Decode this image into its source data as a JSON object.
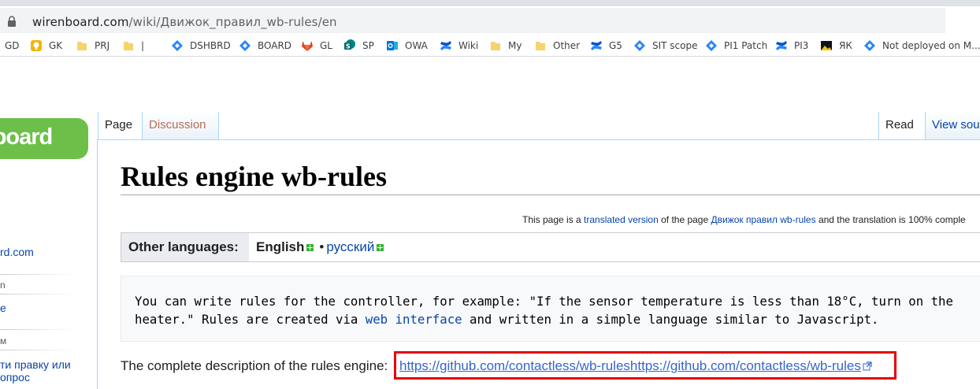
{
  "browser": {
    "url_host": "wirenboard.com",
    "url_path": "/wiki/Движок_правил_wb-rules/en",
    "bookmarks": [
      {
        "label": "GD",
        "icon": "bookmark-favicon"
      },
      {
        "label": "GK",
        "icon": "bulb-icon"
      },
      {
        "label": "PRJ",
        "icon": "folder-icon"
      },
      {
        "label": "|",
        "icon": "folder-icon"
      },
      {
        "label": "DSHBRD",
        "icon": "jira-diamond-icon"
      },
      {
        "label": "BOARD",
        "icon": "jira-diamond-icon"
      },
      {
        "label": "GL",
        "icon": "gitlab-icon"
      },
      {
        "label": "SP",
        "icon": "sharepoint-icon"
      },
      {
        "label": "OWA",
        "icon": "outlook-icon"
      },
      {
        "label": "Wiki",
        "icon": "confluence-icon"
      },
      {
        "label": "My",
        "icon": "folder-icon"
      },
      {
        "label": "Other",
        "icon": "folder-icon"
      },
      {
        "label": "G5",
        "icon": "confluence-icon"
      },
      {
        "label": "SIT scope",
        "icon": "jira-diamond-icon"
      },
      {
        "label": "PI1 Patch",
        "icon": "jira-diamond-icon"
      },
      {
        "label": "PI3",
        "icon": "confluence-icon"
      },
      {
        "label": "ЯК",
        "icon": "image-icon"
      },
      {
        "label": "Not deployed on M...",
        "icon": "jira-diamond-icon"
      }
    ]
  },
  "wiki": {
    "logo_text": "nboard",
    "sidebar": {
      "link1": "rd.com",
      "head1": "n",
      "link2": "e",
      "head2": "м",
      "link3a": "ти правку или",
      "link3b": "опрос"
    },
    "tabs": {
      "page": "Page",
      "discussion": "Discussion",
      "read": "Read",
      "view_source": "View sou"
    },
    "title": "Rules engine wb-rules",
    "translation_notice": {
      "prefix": "This page is a ",
      "link1": "translated version",
      "middle": " of the page ",
      "link2": "Движок правил wb-rules",
      "suffix": " and the translation is 100% comple"
    },
    "languages": {
      "label": "Other languages:",
      "current": "English",
      "separator": "•",
      "other": "русский"
    },
    "note": {
      "text_a": "You can write rules for the controller, for example: \"If the sensor temperature is less than 18°C, turn on the heater.\" Rules are created via ",
      "link": "web interface",
      "text_b": " and written in a simple language similar to Javascript."
    },
    "description": {
      "label": "The complete description of the rules engine:",
      "link": "https://github.com/contactless/wb-ruleshttps://github.com/contactless/wb-rules"
    }
  },
  "colors": {
    "link": "#0645ad",
    "external_link": "#3366cc",
    "highlight_box": "#e8000b",
    "logo_green": "#6cc04a"
  }
}
